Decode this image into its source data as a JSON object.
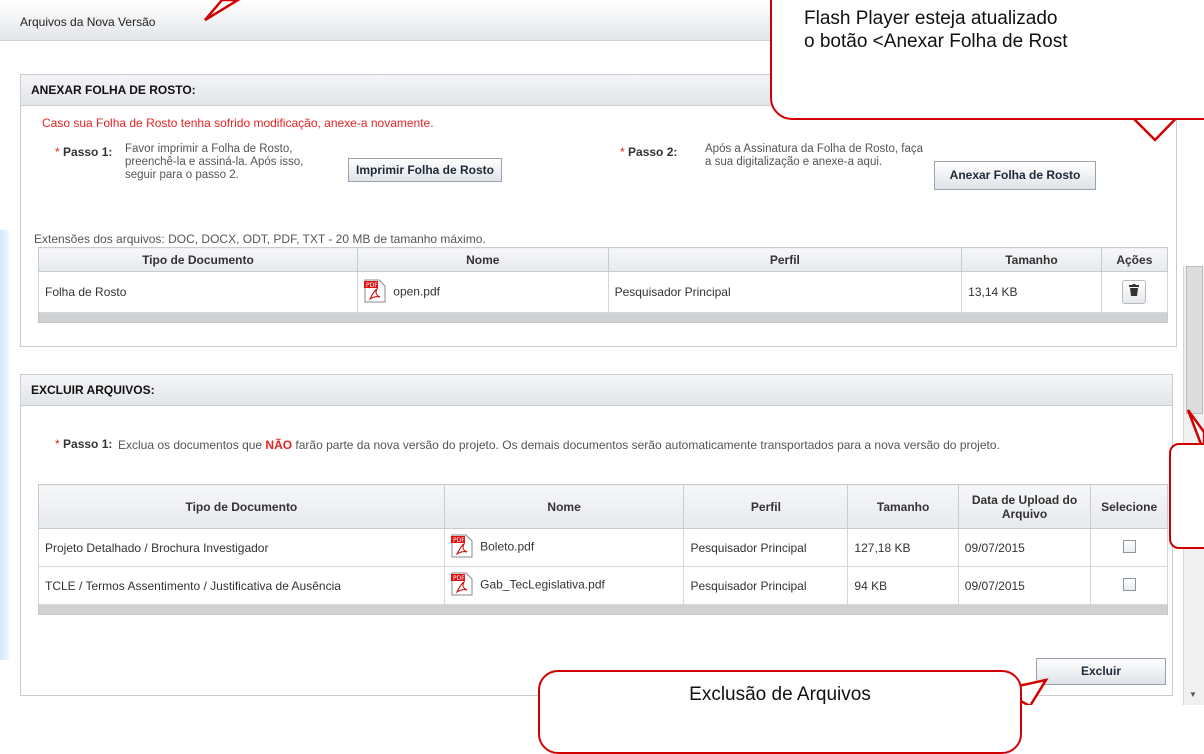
{
  "page": {
    "title": "Arquivos da Nova Versão"
  },
  "callouts": {
    "top_line1": "Flash Player esteja atualizado",
    "top_line2": "o botão <Anexar Folha de Rost",
    "bottom": "Exclusão de Arquivos"
  },
  "anexar": {
    "header": "ANEXAR FOLHA DE ROSTO:",
    "alert": "Caso sua Folha de Rosto tenha sofrido modificação, anexe-a novamente.",
    "step1": {
      "star": "*",
      "label": "Passo 1:",
      "text": "Favor imprimir a Folha de Rosto, preenchê-la e assiná-la. Após isso, seguir para o passo 2.",
      "button": "Imprimir Folha de Rosto"
    },
    "step2": {
      "star": "*",
      "label": "Passo 2:",
      "text": "Após a Assinatura da Folha de Rosto, faça a sua digitalização e anexe-a aqui.",
      "button": "Anexar Folha de Rosto"
    },
    "extensions": "Extensões dos arquivos: DOC, DOCX, ODT, PDF, TXT - 20 MB de tamanho máximo.",
    "table": {
      "headers": [
        "Tipo de Documento",
        "Nome",
        "Perfil",
        "Tamanho",
        "Ações"
      ],
      "rows": [
        {
          "tipo": "Folha de Rosto",
          "nome": "open.pdf",
          "perfil": "Pesquisador Principal",
          "tamanho": "13,14 KB",
          "acao_icon": "trash-icon"
        }
      ]
    }
  },
  "excluir": {
    "header": "EXCLUIR ARQUIVOS:",
    "step1": {
      "star": "*",
      "label": "Passo 1:",
      "text_before": "Exclua os documentos que ",
      "text_warn": "NÃO",
      "text_after": " farão parte da nova versão do projeto. Os demais documentos serão automaticamente transportados para a nova versão do projeto."
    },
    "table": {
      "headers": [
        "Tipo de Documento",
        "Nome",
        "Perfil",
        "Tamanho",
        "Data de Upload do Arquivo",
        "Selecione"
      ],
      "rows": [
        {
          "tipo": "Projeto Detalhado / Brochura Investigador",
          "nome": "Boleto.pdf",
          "perfil": "Pesquisador Principal",
          "tamanho": "127,18 KB",
          "data": "09/07/2015",
          "checked": false
        },
        {
          "tipo": "TCLE / Termos Assentimento / Justificativa de Ausência",
          "nome": "Gab_TecLegislativa.pdf",
          "perfil": "Pesquisador Principal",
          "tamanho": "94 KB",
          "data": "09/07/2015",
          "checked": false
        }
      ]
    },
    "button": "Excluir"
  },
  "colors": {
    "callout_border": "#d10000",
    "alert": "#e52323",
    "header_gradient_top": "#f4f5f7",
    "header_gradient_bottom": "#e2e5e9"
  }
}
